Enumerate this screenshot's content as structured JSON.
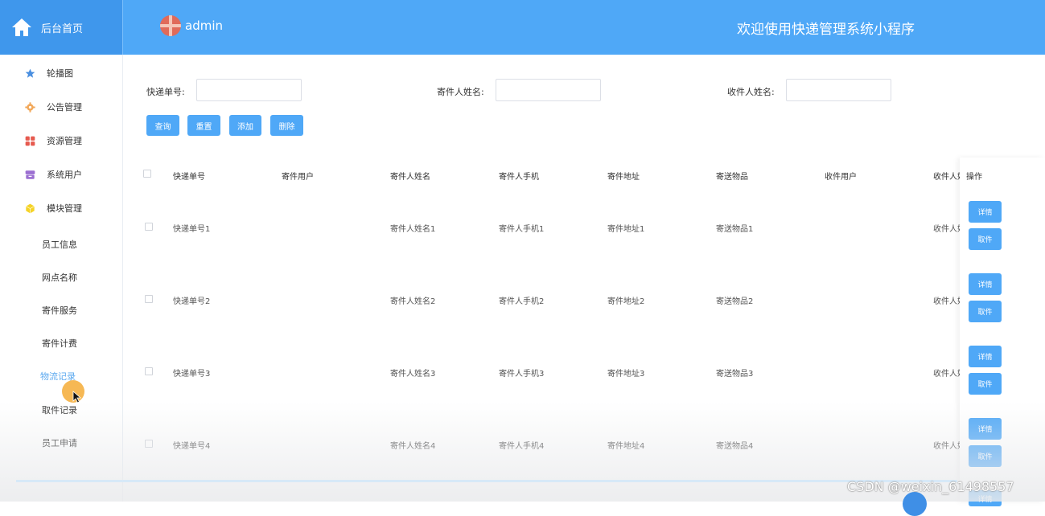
{
  "header": {
    "brand": "后台首页",
    "user": "admin",
    "welcome": "欢迎使用快递管理系统小程序"
  },
  "sidebar": {
    "items": [
      {
        "label": "轮播图",
        "icon": "star-icon"
      },
      {
        "label": "公告管理",
        "icon": "gear-icon"
      },
      {
        "label": "资源管理",
        "icon": "grid-icon"
      },
      {
        "label": "系统用户",
        "icon": "user-box-icon"
      },
      {
        "label": "模块管理",
        "icon": "cube-icon"
      }
    ],
    "sub_items": [
      "员工信息",
      "网点名称",
      "寄件服务",
      "寄件计费",
      "物流记录",
      "取件记录",
      "员工申请"
    ],
    "active_sub": "物流记录"
  },
  "search": {
    "label1": "快递单号:",
    "label2": "寄件人姓名:",
    "label3": "收件人姓名:",
    "value1": "",
    "value2": "",
    "value3": ""
  },
  "actions": {
    "query": "查询",
    "reset": "重置",
    "add": "添加",
    "delete": "删除"
  },
  "table": {
    "headers": [
      "快递单号",
      "寄件用户",
      "寄件人姓名",
      "寄件人手机",
      "寄件地址",
      "寄送物品",
      "收件用户",
      "收件人姓",
      "操作"
    ],
    "rows": [
      {
        "no": "快递单号1",
        "user": "",
        "name": "寄件人姓名1",
        "phone": "寄件人手机1",
        "addr": "寄件地址1",
        "item": "寄送物品1",
        "recv_user": "",
        "recv_name": "收件人姓"
      },
      {
        "no": "快递单号2",
        "user": "",
        "name": "寄件人姓名2",
        "phone": "寄件人手机2",
        "addr": "寄件地址2",
        "item": "寄送物品2",
        "recv_user": "",
        "recv_name": "收件人姓"
      },
      {
        "no": "快递单号3",
        "user": "",
        "name": "寄件人姓名3",
        "phone": "寄件人手机3",
        "addr": "寄件地址3",
        "item": "寄送物品3",
        "recv_user": "",
        "recv_name": "收件人姓"
      },
      {
        "no": "快递单号4",
        "user": "",
        "name": "寄件人姓名4",
        "phone": "寄件人手机4",
        "addr": "寄件地址4",
        "item": "寄送物品4",
        "recv_user": "",
        "recv_name": "收件人姓"
      }
    ],
    "detail_label": "详情",
    "pickup_label": "取件"
  },
  "watermark": "CSDN @weixin_61498557",
  "colors": {
    "header": "#4fa8f7",
    "brand": "#3f97ec",
    "button": "#4fa8f7",
    "active_menu": "#5aa8ef"
  }
}
